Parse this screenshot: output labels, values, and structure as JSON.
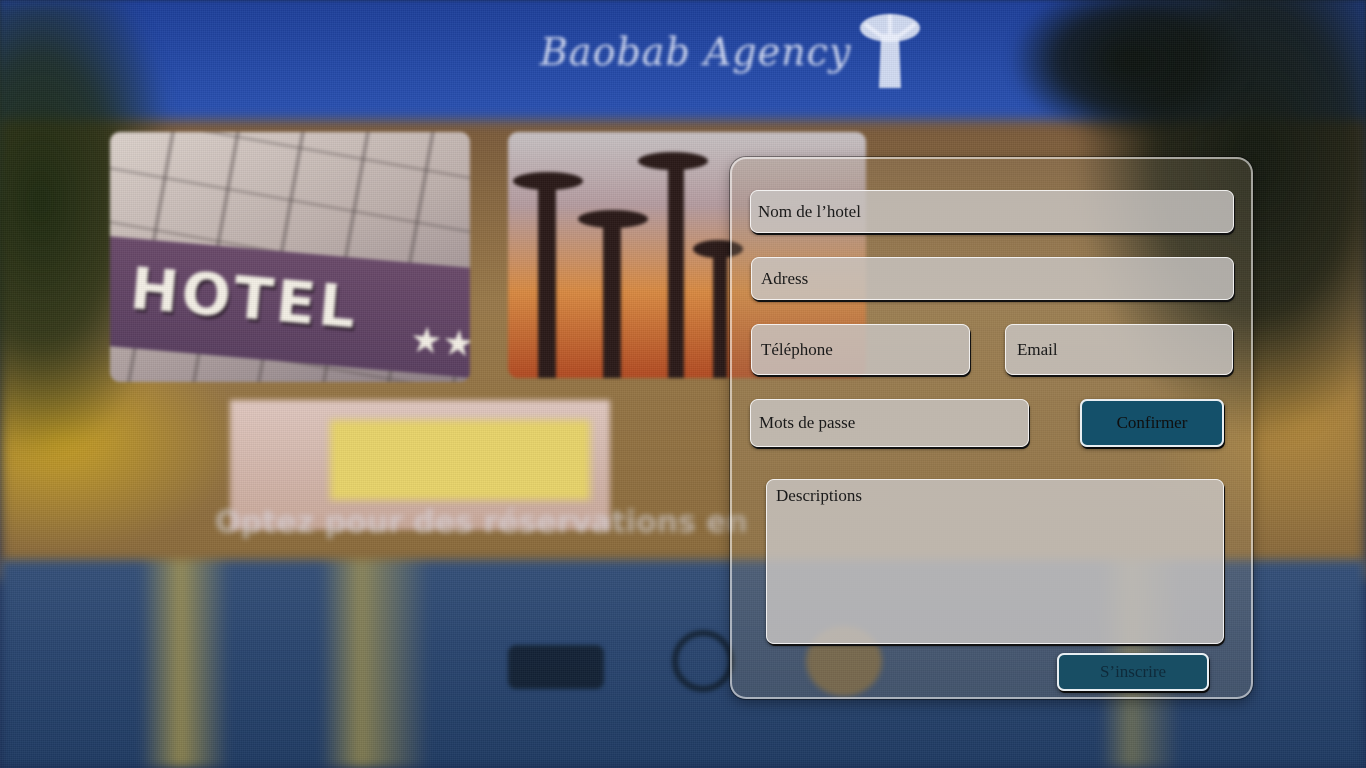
{
  "brand": {
    "wordmark": "Baobab Agency",
    "logo_icon": "baobab-tree-icon"
  },
  "background": {
    "hotel_sign": "HOTEL",
    "hotel_stars": "★★",
    "tagline": "Optez pour des réservations en",
    "colors": {
      "sky": "#2a52b3",
      "pool": "#2a4670"
    }
  },
  "form": {
    "hotel_name_placeholder": "Nom de l’hotel",
    "address_placeholder": "Adress",
    "phone_placeholder": "Téléphone",
    "email_placeholder": "Email",
    "password_placeholder": "Mots de passe",
    "confirm_label": "Confirmer",
    "description_placeholder": "Descriptions",
    "submit_label": "S’inscrire",
    "colors": {
      "button": "#14506a",
      "field": "#c8c4c2"
    }
  }
}
